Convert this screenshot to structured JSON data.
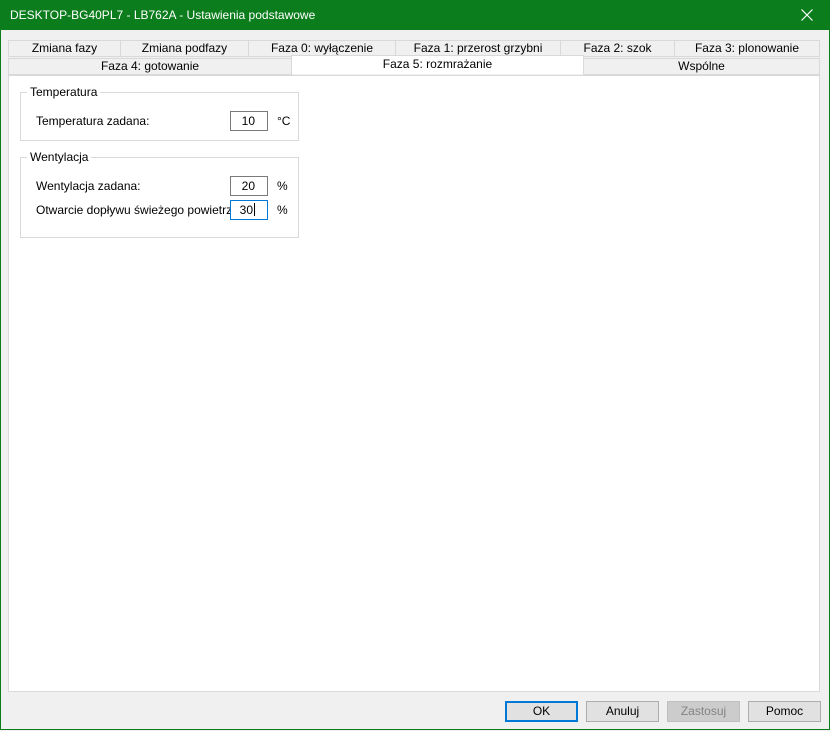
{
  "window": {
    "title": "DESKTOP-BG40PL7 - LB762A - Ustawienia podstawowe",
    "close_icon": "close-icon",
    "accent_color": "#0b7d1d"
  },
  "tabs": {
    "row1": [
      "Zmiana fazy",
      "Zmiana podfazy",
      "Faza 0: wyłączenie",
      "Faza 1: przerost grzybni",
      "Faza 2: szok",
      "Faza 3: plonowanie"
    ],
    "row2": [
      "Faza 4: gotowanie",
      "Faza 5: rozmrażanie",
      "Wspólne"
    ],
    "selected": "Faza 5: rozmrażanie"
  },
  "temperatura": {
    "group_title": "Temperatura",
    "setpoint_label": "Temperatura zadana:",
    "setpoint_value": "10",
    "setpoint_unit": "°C"
  },
  "wentylacja": {
    "group_title": "Wentylacja",
    "setpoint_label": "Wentylacja zadana:",
    "setpoint_value": "20",
    "setpoint_unit": "%",
    "fresh_air_label": "Otwarcie dopływu świeżego powietrza:",
    "fresh_air_value": "30",
    "fresh_air_unit": "%"
  },
  "buttons": {
    "ok": "OK",
    "cancel": "Anuluj",
    "apply": "Zastosuj",
    "help": "Pomoc"
  }
}
